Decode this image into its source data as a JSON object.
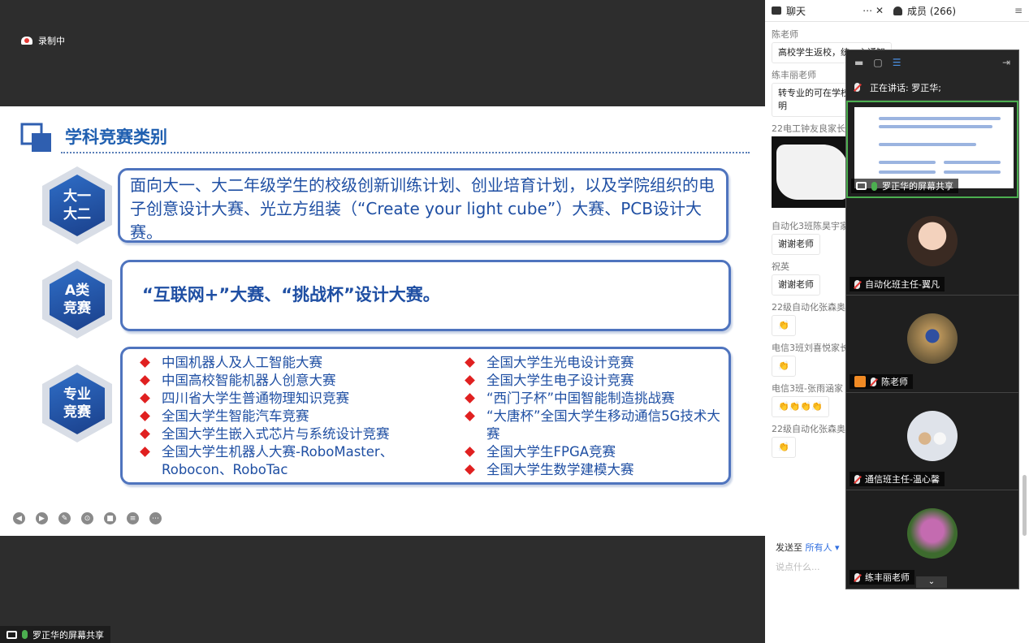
{
  "recording": {
    "label": "录制中"
  },
  "slide": {
    "title": "学科竞赛类别",
    "hex1": {
      "line1": "大一",
      "line2": "大二"
    },
    "hex2": {
      "line1": "A类",
      "line2": "竞赛"
    },
    "hex3": {
      "line1": "专业",
      "line2": "竞赛"
    },
    "box1_text": "面向大一、大二年级学生的校级创新训练计划、创业培育计划，以及学院组织的电子创意设计大赛、光立方组装（“Create your light cube”）大赛、PCB设计大赛。",
    "box2_text": "“互联网+”大赛、“挑战杯”设计大赛。",
    "competitions_left": [
      "中国机器人及人工智能大赛",
      "中国高校智能机器人创意大赛",
      "四川省大学生普通物理知识竞赛",
      "全国大学生智能汽车竞赛",
      "全国大学生嵌入式芯片与系统设计竞赛",
      "全国大学生机器人大赛-RoboMaster、Robocon、RoboTac"
    ],
    "competitions_right": [
      "全国大学生光电设计竞赛",
      "全国大学生电子设计竞赛",
      "“西门子杯”中国智能制造挑战赛",
      "“大唐杯”全国大学生移动通信5G技术大赛",
      "全国大学生FPGA竞赛",
      "全国大学生数学建模大赛"
    ]
  },
  "share_badge": {
    "label": "罗正华的屏幕共享"
  },
  "panel": {
    "tab_chat": "聊天",
    "tab_members": "成员 (266)",
    "chat": [
      {
        "sender": "陈老师",
        "text": "高校学生返校，统一心通知"
      },
      {
        "sender": "练丰丽老师",
        "text": "转专业的可在学校转专业工作通知，说明"
      },
      {
        "sender": "22电工钟友良家长",
        "text": ""
      },
      {
        "sender": "自动化3班陈昊宇家",
        "text": "谢谢老师"
      },
      {
        "sender": "祝英",
        "text": "谢谢老师"
      },
      {
        "sender": "22级自动化张森奥",
        "text": "👏"
      },
      {
        "sender": "电信3班刘喜悦家长",
        "text": "👏"
      },
      {
        "sender": "电信3班-张雨涵家",
        "text": "👏👏👏👏"
      },
      {
        "sender": "22级自动化张森奥",
        "text": "👏"
      }
    ],
    "send_label": "发送至",
    "send_target": "所有人 ▾",
    "input_placeholder": "说点什么..."
  },
  "video": {
    "speaking": "正在讲话: 罗正华;",
    "tiles": [
      {
        "label": "罗正华的屏幕共享"
      },
      {
        "label": "自动化班主任-翼凡"
      },
      {
        "label": "陈老师"
      },
      {
        "label": "通信班主任-温心馨"
      },
      {
        "label": "练丰丽老师"
      }
    ]
  }
}
